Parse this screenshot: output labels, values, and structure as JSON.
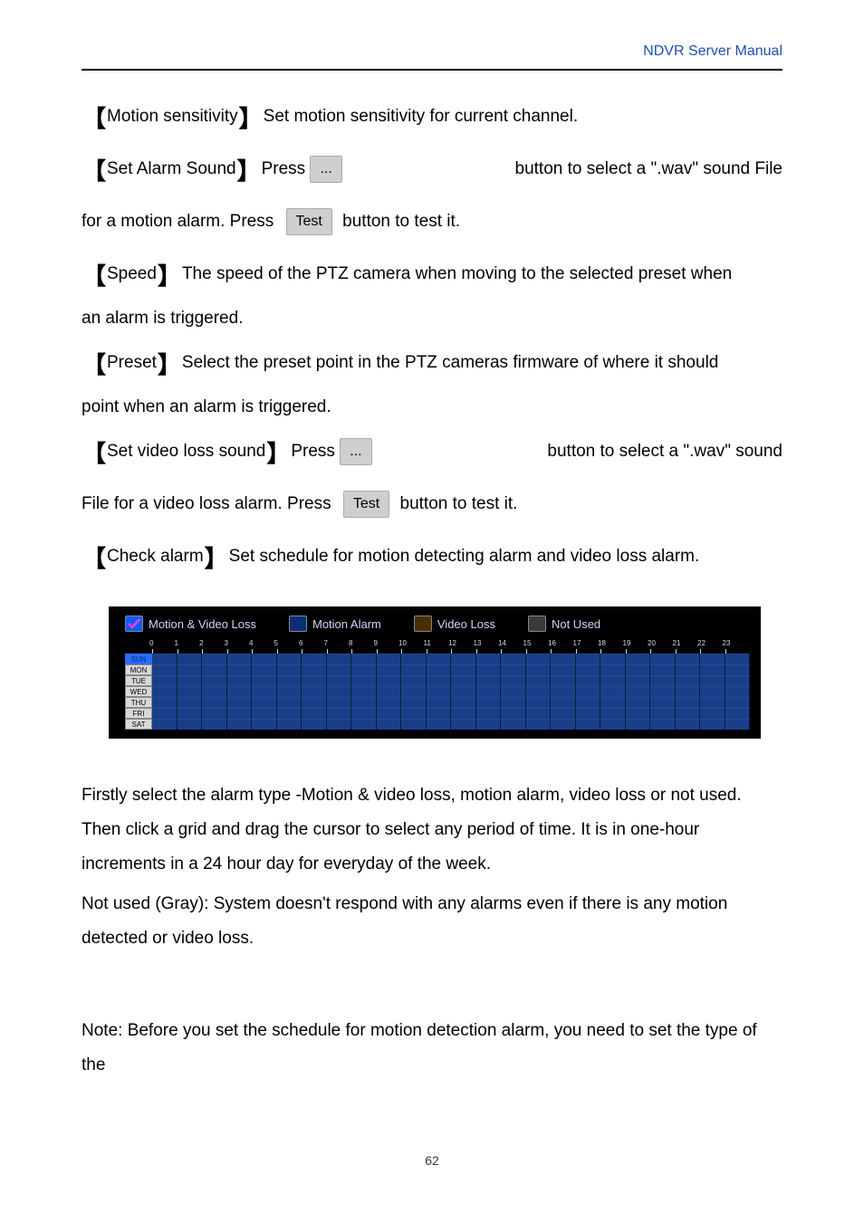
{
  "header": {
    "title": "NDVR Server Manual"
  },
  "rows": {
    "motion_sensitivity": {
      "label": "Motion sensitivity",
      "desc": "Set motion sensitivity for current channel."
    },
    "alarm_sound": {
      "label": "Set Alarm Sound",
      "desc_a": "Press ",
      "browse": "...",
      "desc_b": " button to select a \".wav\" sound File",
      "desc_c": "for a motion alarm. Press ",
      "test": "Test",
      "desc_d": " button to test it."
    },
    "speed": {
      "label": "Speed",
      "desc": "The speed of the PTZ camera when moving to the selected preset when",
      "desc2": "an alarm is triggered."
    },
    "preset": {
      "label": "Preset",
      "desc": "Select the preset point in the PTZ cameras firmware of where it should",
      "desc2": "point when an alarm is triggered."
    },
    "vloss_sound": {
      "label": "Set video loss sound",
      "desc_a": "Press ",
      "browse": "...",
      "desc_b": " button to select a \".wav\" sound",
      "desc_c": "File for a video loss alarm. Press ",
      "test": "Test",
      "desc_d": " button to test it."
    },
    "schedule": {
      "label": "Check alarm",
      "desc": "Set schedule for motion detecting alarm and video loss alarm."
    }
  },
  "schedule": {
    "legend": [
      "Motion & Video Loss",
      "Motion Alarm",
      "Video Loss",
      "Not Used"
    ],
    "hours": [
      "0",
      "1",
      "2",
      "3",
      "4",
      "5",
      "6",
      "7",
      "8",
      "9",
      "10",
      "11",
      "12",
      "13",
      "14",
      "15",
      "16",
      "17",
      "18",
      "19",
      "20",
      "21",
      "22",
      "23"
    ],
    "days": [
      "SUN",
      "MON",
      "TUE",
      "WED",
      "THU",
      "FRI",
      "SAT"
    ]
  },
  "paragraphs": [
    "Firstly select the alarm type -Motion & video loss, motion alarm, video loss or not used. Then click a grid and drag the cursor to select any period of time. It is in one-hour increments in a 24 hour day for everyday of the week.",
    "Not used (Gray): System doesn't respond with any alarms even if there is any motion detected or video loss.",
    "Note: Before you set the schedule for motion detection alarm, you need to set the type of the"
  ],
  "page_number": "62"
}
